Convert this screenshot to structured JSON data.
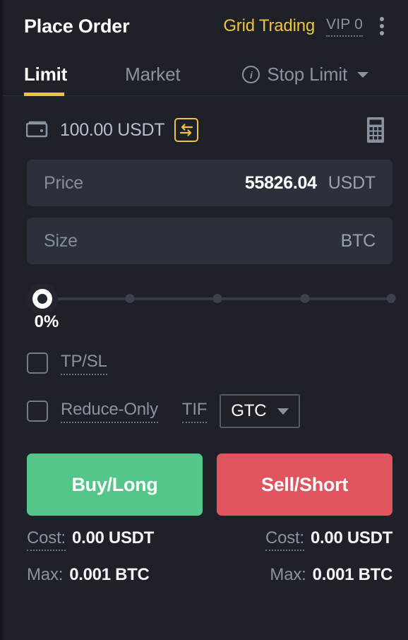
{
  "header": {
    "title": "Place Order",
    "grid_trading": "Grid Trading",
    "vip": "VIP 0",
    "menu_icon": "kebab-menu-icon"
  },
  "tabs": [
    {
      "label": "Limit",
      "active": true
    },
    {
      "label": "Market",
      "active": false
    },
    {
      "label": "Stop Limit",
      "active": false
    }
  ],
  "balance": {
    "wallet_icon": "wallet-icon",
    "amount": "100.00 USDT",
    "swap_icon": "swap-arrows-icon",
    "calculator_icon": "calculator-icon"
  },
  "price_field": {
    "label": "Price",
    "value": "55826.04",
    "unit": "USDT"
  },
  "size_field": {
    "label": "Size",
    "value": "",
    "unit": "BTC"
  },
  "slider": {
    "percent_label": "0%",
    "value": 0,
    "stops": [
      0,
      25,
      50,
      75,
      100
    ]
  },
  "options": {
    "tpsl_label": "TP/SL",
    "tpsl_checked": false,
    "reduce_only_label": "Reduce-Only",
    "reduce_only_checked": false,
    "tif_label": "TIF",
    "tif_value": "GTC"
  },
  "actions": {
    "buy_label": "Buy/Long",
    "sell_label": "Sell/Short",
    "buy_color": "#54c68a",
    "sell_color": "#e0545f"
  },
  "summary": {
    "buy_cost_key": "Cost:",
    "buy_cost_value": "0.00 USDT",
    "sell_cost_key": "Cost:",
    "sell_cost_value": "0.00 USDT",
    "buy_max_key": "Max:",
    "buy_max_value": "0.001 BTC",
    "sell_max_key": "Max:",
    "sell_max_value": "0.001 BTC"
  }
}
